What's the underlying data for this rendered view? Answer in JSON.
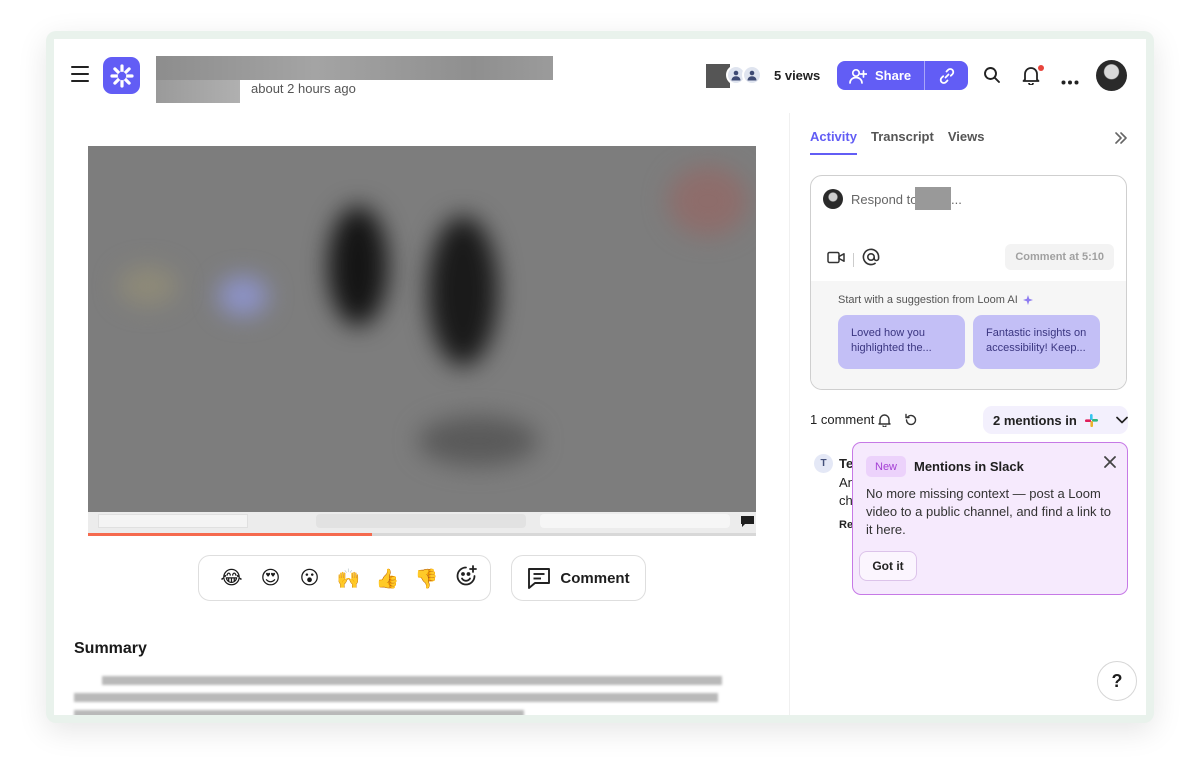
{
  "header": {
    "time_label": "about 2 hours ago",
    "views_label": "5 views",
    "share_label": "Share"
  },
  "icons": {
    "menu": "hamburger-icon",
    "logo": "loom-logo",
    "share": "add-user-icon",
    "link": "link-icon",
    "search": "search-icon",
    "notifications": "bell-icon",
    "more": "more-icon",
    "collapse": "double-chevron-right-icon",
    "video": "video-camera-icon",
    "mention": "at-icon",
    "sparkle": "sparkle-icon",
    "slack": "slack-icon",
    "close": "close-icon"
  },
  "reactions": [
    "😂",
    "😍",
    "😮",
    "🙌",
    "👍",
    "👎"
  ],
  "comment_button": {
    "label": "Comment"
  },
  "summary": {
    "heading": "Summary"
  },
  "panel": {
    "tabs": [
      {
        "label": "Activity",
        "active": true
      },
      {
        "label": "Transcript",
        "active": false
      },
      {
        "label": "Views",
        "active": false
      }
    ],
    "composer": {
      "respond_prefix": "Respond to",
      "respond_suffix": "...",
      "comment_at": "Comment at 5:10",
      "ai_label": "Start with a suggestion from Loom AI",
      "suggestions": [
        "Loved how you highlighted the...",
        "Fantastic insights on accessibility! Keep..."
      ]
    },
    "comment_count": "1 comment",
    "mentions_label": "2 mentions in",
    "comment_fragments": {
      "avatar_initial": "T",
      "name": "Te",
      "line1": "An",
      "line2": "ch",
      "reply": "Re"
    },
    "popover": {
      "badge": "New",
      "title": "Mentions in Slack",
      "body": "No more missing context — post a Loom video to a public channel, and find a link to it here.",
      "button": "Got it"
    },
    "help_label": "?"
  },
  "colors": {
    "accent": "#625df5",
    "progress": "#f56a4e",
    "popover_bg": "#f6eafd",
    "popover_border": "#c679e6",
    "suggestion_bg": "#c3bff6"
  },
  "video_progress_fraction": 0.425
}
